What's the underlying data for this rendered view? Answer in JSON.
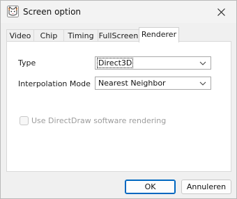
{
  "window": {
    "title": "Screen option",
    "icon": "cat-app-icon",
    "close_icon": "close-icon"
  },
  "tabs": [
    {
      "label": "Video",
      "active": false
    },
    {
      "label": "Chip",
      "active": false
    },
    {
      "label": "Timing",
      "active": false
    },
    {
      "label": "FullScreen",
      "active": false
    },
    {
      "label": "Renderer",
      "active": true
    }
  ],
  "renderer": {
    "type_label": "Type",
    "type_value": "Direct3D",
    "interpolation_label": "Interpolation Mode",
    "interpolation_value": "Nearest Neighbor",
    "directdraw_label": "Use DirectDraw software rendering",
    "directdraw_checked": false,
    "directdraw_enabled": false
  },
  "buttons": {
    "ok_label": "OK",
    "cancel_label": "Annuleren"
  },
  "colors": {
    "accent": "#0067c0",
    "disabled_text": "#9c9c9c"
  }
}
